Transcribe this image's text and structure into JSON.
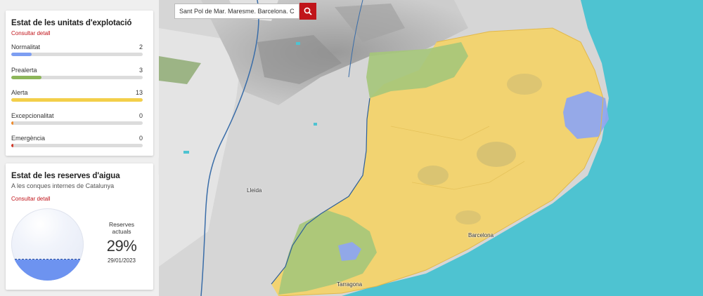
{
  "units_card": {
    "title": "Estat de les unitats d'explotació",
    "link": "Consultar detall",
    "max": 13,
    "stats": [
      {
        "label": "Normalitat",
        "count": 2,
        "color": "#7d9ef2"
      },
      {
        "label": "Prealerta",
        "count": 3,
        "color": "#8db65a"
      },
      {
        "label": "Alerta",
        "count": 13,
        "color": "#f3cf4a"
      },
      {
        "label": "Excepcionalitat",
        "count": 0,
        "color": "#ef8b2c"
      },
      {
        "label": "Emergència",
        "count": 0,
        "color": "#d23a2a"
      }
    ]
  },
  "reserves_card": {
    "title": "Estat de les reserves d'aigua",
    "subtitle": "A les conques internes de Catalunya",
    "link": "Consultar detall",
    "label_line1": "Reserves",
    "label_line2": "actuals",
    "percentage": "29%",
    "fill_fraction": 0.29,
    "date": "29/01/2023"
  },
  "search": {
    "value": "Sant Pol de Mar. Maresme. Barcelona. Catalunya"
  },
  "map": {
    "labels": {
      "lleida": "Lleida",
      "barcelona": "Barcelona",
      "tarragona": "Tarragona"
    },
    "colors": {
      "sea": "#4ec3d1",
      "alerta": "#f3d36b",
      "prealerta": "#a5c77a",
      "normalitat": "#8fa6ee",
      "terrain": "#cfcfcf"
    }
  }
}
